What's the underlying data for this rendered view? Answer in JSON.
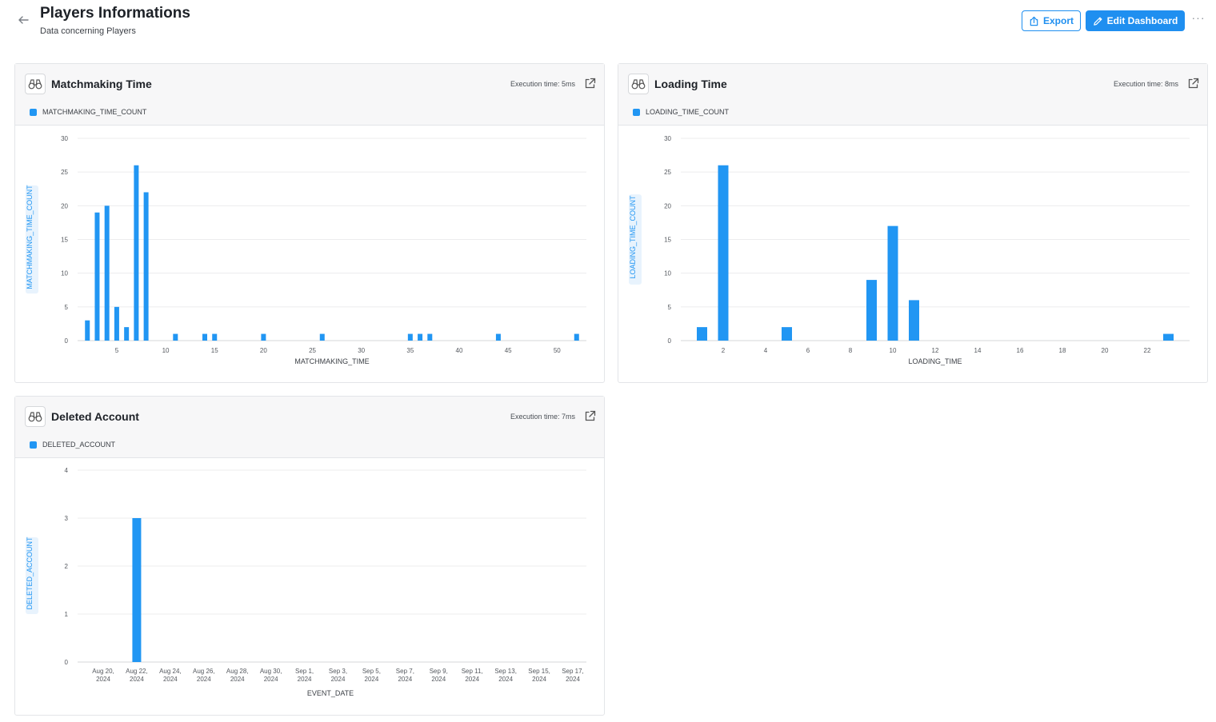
{
  "header": {
    "title": "Players Informations",
    "subtitle": "Data concerning Players",
    "export_label": "Export",
    "edit_label": "Edit Dashboard",
    "more_label": "···"
  },
  "colors": {
    "accent": "#1f8ff0",
    "bar": "#2196f3",
    "axis_label": "#2196f3"
  },
  "icons": {
    "back": "arrow-left-icon",
    "card": "binoculars-icon",
    "open": "external-link-icon",
    "export": "share-icon",
    "edit": "pencil-icon"
  },
  "cards": [
    {
      "title": "Matchmaking Time",
      "exec": "Execution time: 5ms",
      "legend": "MATCHMAKING_TIME_COUNT"
    },
    {
      "title": "Loading Time",
      "exec": "Execution time: 8ms",
      "legend": "LOADING_TIME_COUNT"
    },
    {
      "title": "Deleted Account",
      "exec": "Execution time: 7ms",
      "legend": "DELETED_ACCOUNT"
    }
  ],
  "chart_data": [
    {
      "type": "bar",
      "xlabel": "MATCHMAKING_TIME",
      "ylabel": "MATCHMAKING_TIME_COUNT",
      "xlim": [
        1,
        53
      ],
      "ylim": [
        0,
        30
      ],
      "xticks": [
        5,
        10,
        15,
        20,
        25,
        30,
        35,
        40,
        45,
        50
      ],
      "yticks": [
        0,
        5,
        10,
        15,
        20,
        25,
        30
      ],
      "grid": true,
      "legend_position": "top-left",
      "series": [
        {
          "name": "MATCHMAKING_TIME_COUNT",
          "x": [
            2,
            3,
            4,
            5,
            6,
            7,
            8,
            11,
            14,
            15,
            20,
            26,
            35,
            36,
            37,
            44,
            52
          ],
          "values": [
            3,
            19,
            20,
            5,
            2,
            26,
            22,
            1,
            1,
            1,
            1,
            1,
            1,
            1,
            1,
            1,
            1
          ]
        }
      ]
    },
    {
      "type": "bar",
      "xlabel": "LOADING_TIME",
      "ylabel": "LOADING_TIME_COUNT",
      "xlim": [
        0,
        24
      ],
      "ylim": [
        0,
        30
      ],
      "xticks": [
        2,
        4,
        6,
        8,
        10,
        12,
        14,
        16,
        18,
        20,
        22
      ],
      "yticks": [
        0,
        5,
        10,
        15,
        20,
        25,
        30
      ],
      "grid": true,
      "legend_position": "top-left",
      "series": [
        {
          "name": "LOADING_TIME_COUNT",
          "x": [
            1,
            2,
            5,
            9,
            10,
            11,
            23
          ],
          "values": [
            2,
            26,
            2,
            9,
            17,
            6,
            1
          ]
        }
      ]
    },
    {
      "type": "bar",
      "xlabel": "EVENT_DATE",
      "ylabel": "DELETED_ACCOUNT",
      "ylim": [
        0,
        4
      ],
      "yticks": [
        0,
        1,
        2,
        3,
        4
      ],
      "grid": true,
      "legend_position": "top-left",
      "categories": [
        [
          "Aug 20,",
          "2024"
        ],
        [
          "Aug 22,",
          "2024"
        ],
        [
          "Aug 24,",
          "2024"
        ],
        [
          "Aug 26,",
          "2024"
        ],
        [
          "Aug 28,",
          "2024"
        ],
        [
          "Aug 30,",
          "2024"
        ],
        [
          "Sep 1,",
          "2024"
        ],
        [
          "Sep 3,",
          "2024"
        ],
        [
          "Sep 5,",
          "2024"
        ],
        [
          "Sep 7,",
          "2024"
        ],
        [
          "Sep 9,",
          "2024"
        ],
        [
          "Sep 11,",
          "2024"
        ],
        [
          "Sep 13,",
          "2024"
        ],
        [
          "Sep 15,",
          "2024"
        ],
        [
          "Sep 17,",
          "2024"
        ]
      ],
      "series": [
        {
          "name": "DELETED_ACCOUNT",
          "values": [
            0,
            3,
            0,
            0,
            0,
            0,
            0,
            0,
            0,
            0,
            0,
            0,
            0,
            0,
            0
          ]
        }
      ]
    }
  ]
}
